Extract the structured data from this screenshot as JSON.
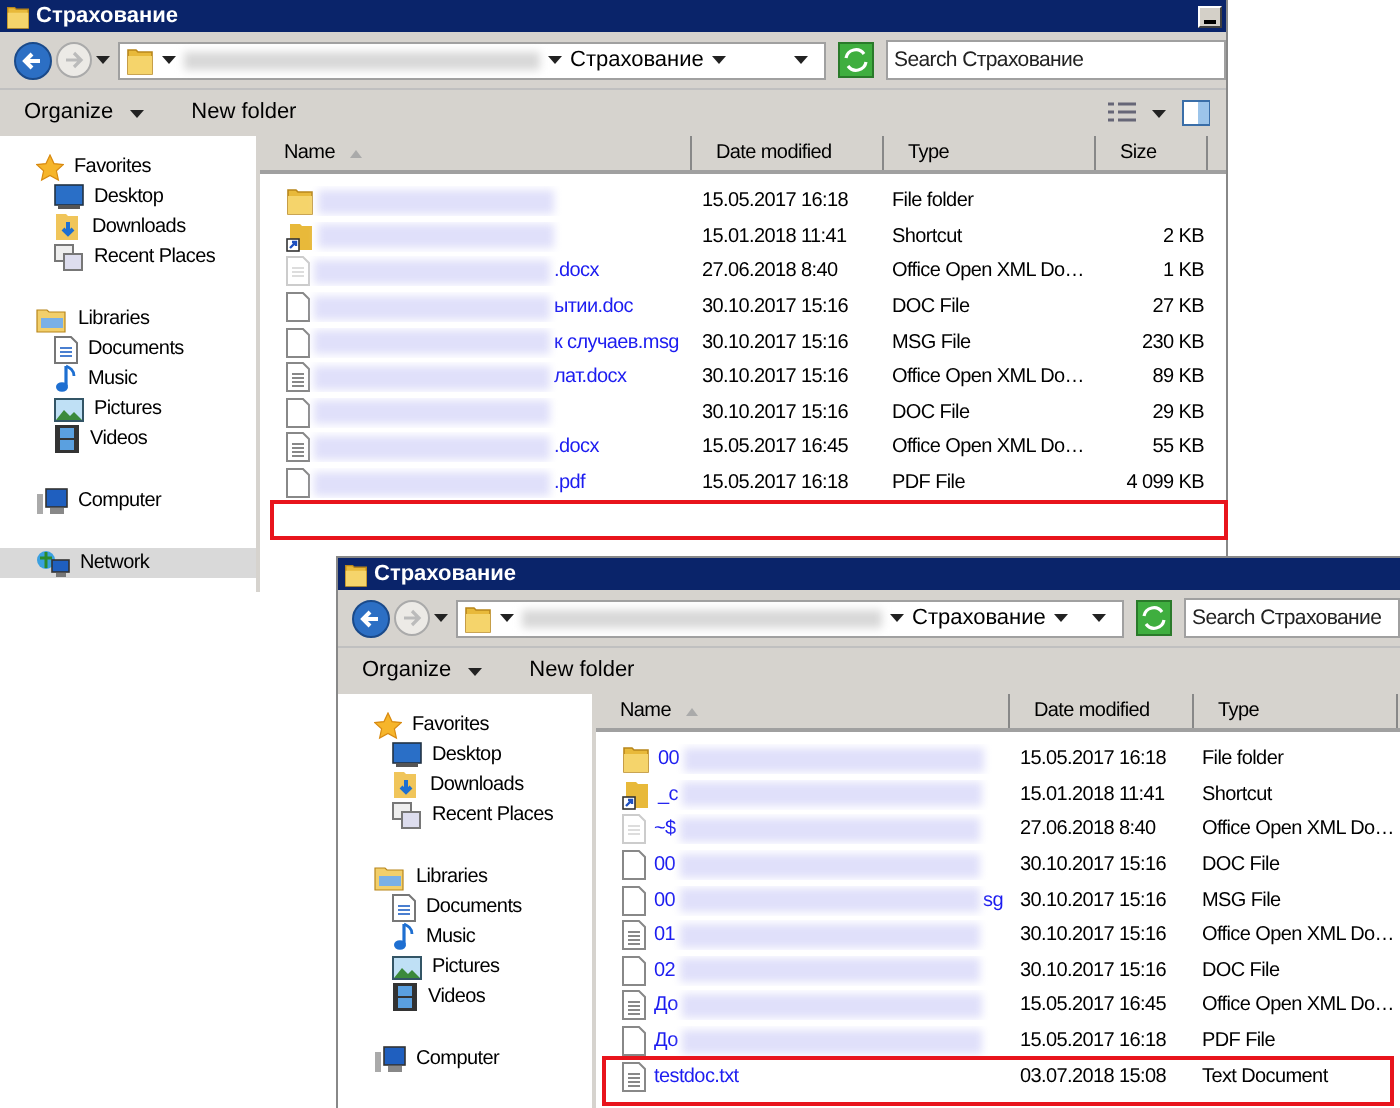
{
  "windows": [
    {
      "title": "Страхование",
      "address": "Страхование",
      "search_placeholder": "Search Страхование",
      "toolbar": [
        "Organize",
        "New folder"
      ],
      "sidebar": [
        {
          "label": "Favorites",
          "kind": "star",
          "selected": false,
          "children": [
            {
              "label": "Desktop",
              "kind": "desktop",
              "selected": false
            },
            {
              "label": "Downloads",
              "kind": "downloads",
              "selected": false
            },
            {
              "label": "Recent Places",
              "kind": "recent",
              "selected": false
            }
          ]
        },
        {
          "label": "Libraries",
          "kind": "libraries",
          "selected": false,
          "children": [
            {
              "label": "Documents",
              "kind": "documents",
              "selected": false
            },
            {
              "label": "Music",
              "kind": "music",
              "selected": false
            },
            {
              "label": "Pictures",
              "kind": "pictures",
              "selected": false
            },
            {
              "label": "Videos",
              "kind": "videos",
              "selected": false
            }
          ]
        },
        {
          "label": "Computer",
          "kind": "computer",
          "selected": false
        },
        {
          "label": "Network",
          "kind": "network",
          "selected": true
        }
      ],
      "columns": [
        "Name",
        "Date modified",
        "Type",
        "Size"
      ],
      "rows": [
        {
          "kind": "folder",
          "date": "15.05.2017 16:18",
          "type": "File folder"
        },
        {
          "kind": "shortcut",
          "date": "15.01.2018 11:41",
          "type": "Shortcut",
          "size": "2 KB"
        },
        {
          "kind": "temp",
          "name_end": ".docx",
          "date": "27.06.2018 8:40",
          "type": "Office Open XML Do…",
          "size": "1 KB"
        },
        {
          "kind": "file",
          "name_end": "ытии.doc",
          "date": "30.10.2017 15:16",
          "type": "DOC File",
          "size": "27 KB"
        },
        {
          "kind": "file",
          "name_end": "к случаев.msg",
          "date": "30.10.2017 15:16",
          "type": "MSG File",
          "size": "230 KB"
        },
        {
          "kind": "text",
          "name_end": "лат.docx",
          "date": "30.10.2017 15:16",
          "type": "Office Open XML Do…",
          "size": "89 KB"
        },
        {
          "kind": "file",
          "date": "30.10.2017 15:16",
          "type": "DOC File",
          "size": "29 KB"
        },
        {
          "kind": "text",
          "name_end": ".docx",
          "date": "15.05.2017 16:45",
          "type": "Office Open XML Do…",
          "size": "55 KB"
        },
        {
          "kind": "file",
          "name_end": ".pdf",
          "date": "15.05.2017 16:18",
          "type": "PDF File",
          "size": "4 099 KB"
        }
      ]
    },
    {
      "title": "Страхование",
      "address": "Страхование",
      "search_placeholder": "Search Страхование",
      "toolbar": [
        "Organize",
        "New folder"
      ],
      "sidebar": [
        {
          "label": "Favorites",
          "kind": "star",
          "selected": false,
          "children": [
            {
              "label": "Desktop",
              "kind": "desktop",
              "selected": false
            },
            {
              "label": "Downloads",
              "kind": "downloads",
              "selected": false
            },
            {
              "label": "Recent Places",
              "kind": "recent",
              "selected": false
            }
          ]
        },
        {
          "label": "Libraries",
          "kind": "libraries",
          "selected": false,
          "children": [
            {
              "label": "Documents",
              "kind": "documents",
              "selected": false
            },
            {
              "label": "Music",
              "kind": "music",
              "selected": false
            },
            {
              "label": "Pictures",
              "kind": "pictures",
              "selected": false
            },
            {
              "label": "Videos",
              "kind": "videos",
              "selected": false
            }
          ]
        },
        {
          "label": "Computer",
          "kind": "computer",
          "selected": false
        }
      ],
      "columns": [
        "Name",
        "Date modified",
        "Type"
      ],
      "rows": [
        {
          "kind": "folder",
          "name_start": "00",
          "date": "15.05.2017 16:18",
          "type": "File folder"
        },
        {
          "kind": "shortcut",
          "name_start": "_c",
          "date": "15.01.2018 11:41",
          "type": "Shortcut"
        },
        {
          "kind": "temp",
          "name_start": "~$",
          "date": "27.06.2018 8:40",
          "type": "Office Open XML Do…"
        },
        {
          "kind": "file",
          "name_start": "00",
          "date": "30.10.2017 15:16",
          "type": "DOC File"
        },
        {
          "kind": "file",
          "name_start": "00",
          "name_end": "sg",
          "date": "30.10.2017 15:16",
          "type": "MSG File"
        },
        {
          "kind": "text",
          "name_start": "01",
          "date": "30.10.2017 15:16",
          "type": "Office Open XML Do…"
        },
        {
          "kind": "file",
          "name_start": "02",
          "date": "30.10.2017 15:16",
          "type": "DOC File"
        },
        {
          "kind": "text",
          "name_start": "До",
          "date": "15.05.2017 16:45",
          "type": "Office Open XML Do…"
        },
        {
          "kind": "file",
          "name_start": "До",
          "date": "15.05.2017 16:18",
          "type": "PDF File"
        },
        {
          "kind": "text",
          "name": "testdoc.txt",
          "date": "03.07.2018 15:08",
          "type": "Text Document"
        }
      ]
    }
  ]
}
